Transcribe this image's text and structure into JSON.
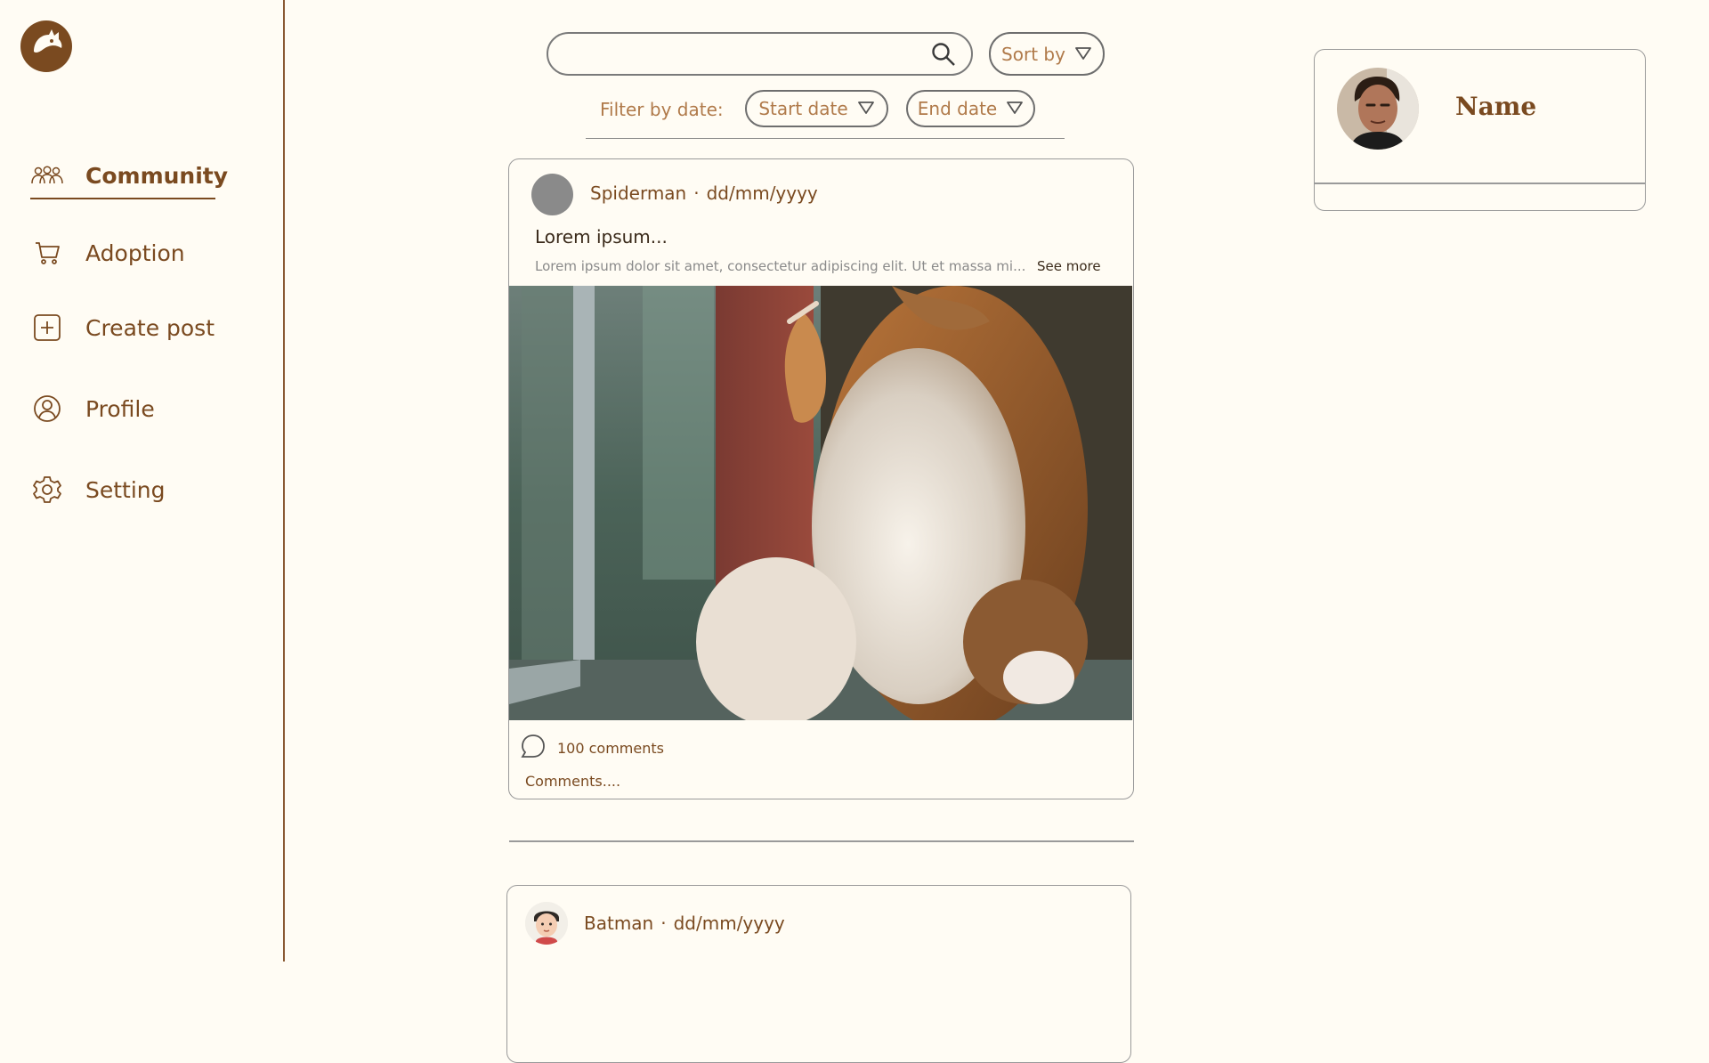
{
  "app": {
    "logo_icon": "cat-moon-logo"
  },
  "sidebar": {
    "items": [
      {
        "label": "Community",
        "icon": "community-icon",
        "active": true
      },
      {
        "label": "Adoption",
        "icon": "cart-icon",
        "active": false
      },
      {
        "label": "Create post",
        "icon": "plus-square-icon",
        "active": false
      },
      {
        "label": "Profile",
        "icon": "user-circle-icon",
        "active": false
      },
      {
        "label": "Setting",
        "icon": "gear-icon",
        "active": false
      }
    ]
  },
  "search": {
    "value": "",
    "placeholder": ""
  },
  "sort": {
    "label": "Sort by"
  },
  "filter": {
    "label": "Filter by date:",
    "start_label": "Start date",
    "end_label": "End date"
  },
  "posts": [
    {
      "author": "Spiderman",
      "separator": "·",
      "date": "dd/mm/yyyy",
      "title": "Lorem ipsum...",
      "excerpt": "Lorem ipsum dolor sit amet, consectetur adipiscing elit. Ut et massa mi...",
      "see_more": "See more",
      "comment_count": "100 comments",
      "comments_preview": "Comments...."
    },
    {
      "author": "Batman",
      "separator": "·",
      "date": "dd/mm/yyyy"
    }
  ],
  "profile": {
    "name": "Name"
  },
  "colors": {
    "background": "#fffcf4",
    "brand_brown": "#7a4a20",
    "muted_brown": "#b07a4a",
    "border_gray": "#9a9a9a"
  }
}
